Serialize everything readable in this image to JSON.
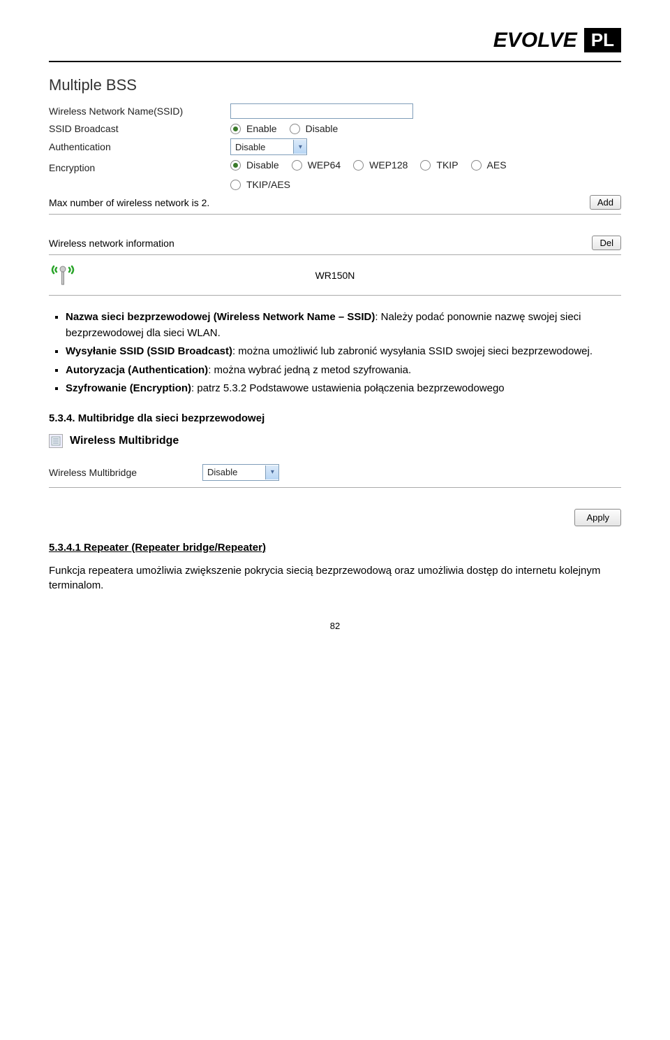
{
  "header": {
    "logo_text": "EVOLVE",
    "country_code": "PL"
  },
  "multiple_bss": {
    "title": "Multiple BSS",
    "rows": {
      "ssid_label": "Wireless Network Name(SSID)",
      "broadcast_label": "SSID Broadcast",
      "auth_label": "Authentication",
      "enc_label": "Encryption",
      "max_note": "Max number of wireless network is 2."
    },
    "broadcast_options": {
      "enable": "Enable",
      "disable": "Disable"
    },
    "auth_select": "Disable",
    "encryption_options": [
      "Disable",
      "WEP64",
      "WEP128",
      "TKIP",
      "AES",
      "TKIP/AES"
    ],
    "add_button": "Add",
    "info_label": "Wireless network information",
    "del_button": "Del",
    "device_name": "WR150N"
  },
  "bullets": [
    {
      "bold": "Nazwa sieci bezprzewodowej (Wireless Network Name – SSID)",
      "rest": ": Należy podać ponownie nazwę swojej sieci bezprzewodowej dla sieci WLAN."
    },
    {
      "bold": "Wysyłanie SSID (SSID Broadcast)",
      "rest": ": można umożliwić lub zabronić wysyłania SSID swojej sieci bezprzewodowej."
    },
    {
      "bold": "Autoryzacja (Authentication)",
      "rest": ": można wybrać jedną z metod szyfrowania."
    },
    {
      "bold": "Szyfrowanie (Encryption)",
      "rest": ": patrz 5.3.2 Podstawowe ustawienia połączenia bezprzewodowego"
    }
  ],
  "section_534": "5.3.4. Multibridge dla sieci bezprzewodowej",
  "multibridge": {
    "title": "Wireless Multibridge",
    "row_label": "Wireless Multibridge",
    "select": "Disable",
    "apply_button": "Apply"
  },
  "section_5341_title": "5.3.4.1 Repeater (Repeater bridge/Repeater)",
  "section_5341_body": "Funkcja repeatera umożliwia zwiększenie pokrycia siecią bezprzewodową oraz umożliwia dostęp do internetu kolejnym terminalom.",
  "page_number": "82"
}
